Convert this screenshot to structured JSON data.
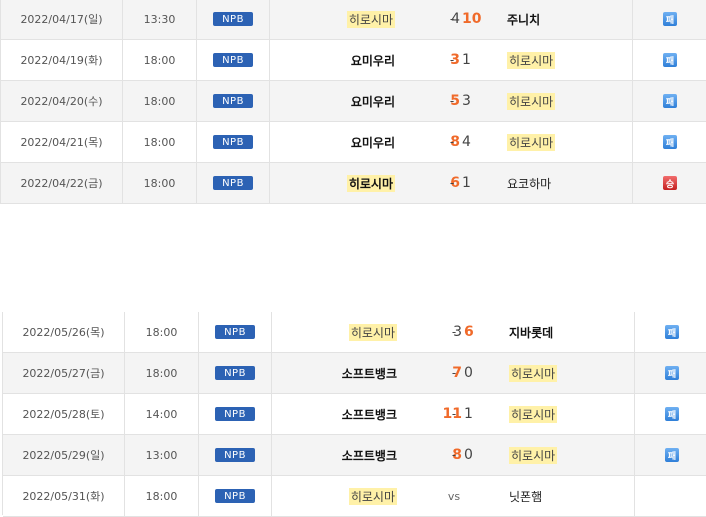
{
  "league_label": "NPB",
  "vs_label": "vs",
  "group1": [
    {
      "date": "2022/04/17(일)",
      "time": "13:30",
      "home": "히로시마",
      "home_hl": true,
      "home_bold": false,
      "home_score": "4",
      "away_score": "10",
      "away": "주니치",
      "away_hl": false,
      "away_bold": true,
      "winner": "away",
      "result": "패",
      "result_type": "lose"
    },
    {
      "date": "2022/04/19(화)",
      "time": "18:00",
      "home": "요미우리",
      "home_hl": false,
      "home_bold": true,
      "home_score": "3",
      "away_score": "1",
      "away": "히로시마",
      "away_hl": true,
      "away_bold": false,
      "winner": "home",
      "result": "패",
      "result_type": "lose"
    },
    {
      "date": "2022/04/20(수)",
      "time": "18:00",
      "home": "요미우리",
      "home_hl": false,
      "home_bold": true,
      "home_score": "5",
      "away_score": "3",
      "away": "히로시마",
      "away_hl": true,
      "away_bold": false,
      "winner": "home",
      "result": "패",
      "result_type": "lose"
    },
    {
      "date": "2022/04/21(목)",
      "time": "18:00",
      "home": "요미우리",
      "home_hl": false,
      "home_bold": true,
      "home_score": "8",
      "away_score": "4",
      "away": "히로시마",
      "away_hl": true,
      "away_bold": false,
      "winner": "home",
      "result": "패",
      "result_type": "lose"
    },
    {
      "date": "2022/04/22(금)",
      "time": "18:00",
      "home": "히로시마",
      "home_hl": true,
      "home_bold": true,
      "home_score": "6",
      "away_score": "1",
      "away": "요코하마",
      "away_hl": false,
      "away_bold": false,
      "winner": "home",
      "result": "승",
      "result_type": "win"
    }
  ],
  "group2": [
    {
      "date": "2022/05/26(목)",
      "time": "18:00",
      "home": "히로시마",
      "home_hl": true,
      "home_bold": false,
      "home_score": "3",
      "away_score": "6",
      "away": "지바롯데",
      "away_hl": false,
      "away_bold": true,
      "winner": "away",
      "result": "패",
      "result_type": "lose"
    },
    {
      "date": "2022/05/27(금)",
      "time": "18:00",
      "home": "소프트뱅크",
      "home_hl": false,
      "home_bold": true,
      "home_score": "7",
      "away_score": "0",
      "away": "히로시마",
      "away_hl": true,
      "away_bold": false,
      "winner": "home",
      "result": "패",
      "result_type": "lose"
    },
    {
      "date": "2022/05/28(토)",
      "time": "14:00",
      "home": "소프트뱅크",
      "home_hl": false,
      "home_bold": true,
      "home_score": "11",
      "away_score": "1",
      "away": "히로시마",
      "away_hl": true,
      "away_bold": false,
      "winner": "home",
      "result": "패",
      "result_type": "lose"
    },
    {
      "date": "2022/05/29(일)",
      "time": "13:00",
      "home": "소프트뱅크",
      "home_hl": false,
      "home_bold": true,
      "home_score": "8",
      "away_score": "0",
      "away": "히로시마",
      "away_hl": true,
      "away_bold": false,
      "winner": "home",
      "result": "패",
      "result_type": "lose"
    },
    {
      "date": "2022/05/31(화)",
      "time": "18:00",
      "home": "히로시마",
      "home_hl": true,
      "home_bold": false,
      "home_score": "",
      "away_score": "",
      "away": "닛폰햄",
      "away_hl": false,
      "away_bold": false,
      "winner": "",
      "result": "",
      "result_type": "none"
    }
  ]
}
